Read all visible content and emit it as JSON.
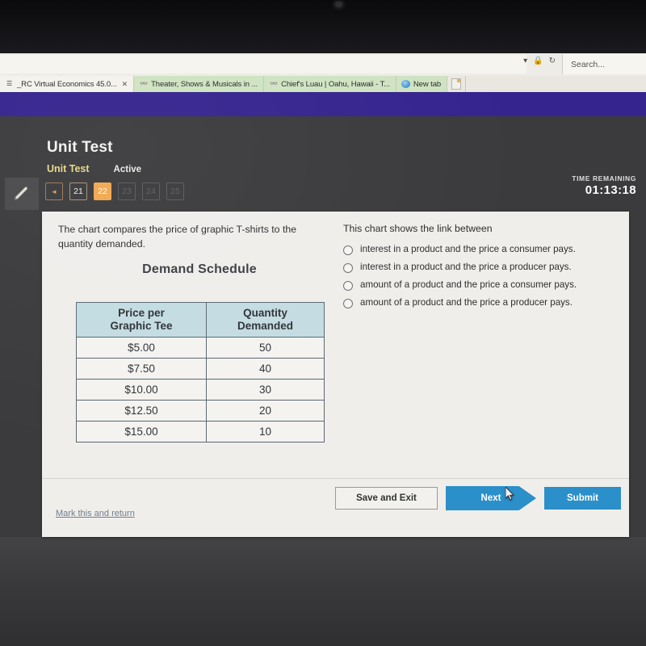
{
  "browser": {
    "search_placeholder": "Search...",
    "icons": [
      "chevron-down-icon",
      "lock-icon",
      "refresh-icon"
    ],
    "tabs": [
      {
        "title": "_RC Virtual Economics 45.0...",
        "favicon": "page-icon",
        "active": true,
        "closeable": true
      },
      {
        "title": "Theater, Shows & Musicals in ...",
        "favicon": "glasses-icon",
        "active": false,
        "closeable": false
      },
      {
        "title": "Chief's Luau | Oahu, Hawaii - T...",
        "favicon": "glasses-icon",
        "active": false,
        "closeable": false
      },
      {
        "title": "New tab",
        "favicon": "ie-icon",
        "active": false,
        "closeable": false
      }
    ]
  },
  "header": {
    "title": "Unit Test",
    "breadcrumb": "Unit Test",
    "state": "Active",
    "timer_label": "TIME REMAINING",
    "timer_value": "01:13:18",
    "prev_label": "◄",
    "questions": [
      {
        "number": "21",
        "state": "done"
      },
      {
        "number": "22",
        "state": "current"
      },
      {
        "number": "23",
        "state": "future"
      },
      {
        "number": "24",
        "state": "future"
      },
      {
        "number": "25",
        "state": "future"
      }
    ]
  },
  "tools": {
    "pencil": "pencil-icon"
  },
  "question": {
    "prompt": "The chart compares the price of graphic T-shirts to the quantity demanded.",
    "chart_title": "Demand Schedule",
    "stem": "This chart shows the link between",
    "options": [
      {
        "label": "interest in a product and the price a consumer pays.",
        "selected": false
      },
      {
        "label": "interest in a product and the price a producer pays.",
        "selected": false
      },
      {
        "label": "amount of a product and the price a consumer pays.",
        "selected": false
      },
      {
        "label": "amount of a product and the price a producer pays.",
        "selected": false
      }
    ]
  },
  "chart_data": {
    "type": "table",
    "title": "Demand Schedule",
    "columns": [
      "Price per Graphic Tee",
      "Quantity Demanded"
    ],
    "column_lines": [
      [
        "Price per",
        "Graphic Tee"
      ],
      [
        "Quantity",
        "Demanded"
      ]
    ],
    "categories": [
      "$5.00",
      "$7.50",
      "$10.00",
      "$12.50",
      "$15.00"
    ],
    "values": [
      50,
      40,
      30,
      20,
      10
    ],
    "rows": [
      [
        "$5.00",
        "50"
      ],
      [
        "$7.50",
        "40"
      ],
      [
        "$10.00",
        "30"
      ],
      [
        "$12.50",
        "20"
      ],
      [
        "$15.00",
        "10"
      ]
    ],
    "xlabel": "Price per Graphic Tee",
    "ylabel": "Quantity Demanded",
    "header_color": "#c3dce2"
  },
  "footer": {
    "mark_link": "Mark this and return",
    "save_label": "Save and Exit",
    "next_label": "Next",
    "submit_label": "Submit"
  },
  "colors": {
    "accent_orange": "#f2a74f",
    "accent_blue": "#2b8fc9",
    "chrome_purple": "#35248e",
    "table_header": "#c3dce2"
  }
}
